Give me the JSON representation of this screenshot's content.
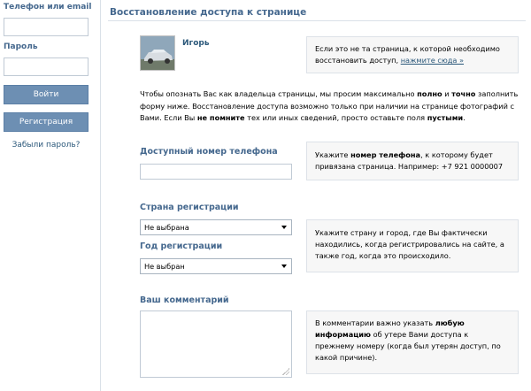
{
  "sidebar": {
    "login_label": "Телефон или email",
    "password_label": "Пароль",
    "login_button": "Войти",
    "register_button": "Регистрация",
    "forgot_link": "Забыли пароль?"
  },
  "main": {
    "title": "Восстановление доступа к странице",
    "user": {
      "name": "Игорь"
    },
    "wrong_page_hint": {
      "text": "Если это не та страница, к которой необходимо восстановить доступ,",
      "link": "нажмите сюда »"
    },
    "intro": {
      "p1": "Чтобы опознать Вас как владельца страницы, мы просим максимально ",
      "b1": "полно",
      "p2": " и ",
      "b2": "точно",
      "p3": " заполнить форму ниже. Восстановление доступа возможно только при наличии на странице фотографий с Вами. Если Вы ",
      "b3": "не помните",
      "p4": " тех или иных сведений, просто оставьте поля ",
      "b4": "пустыми",
      "p5": "."
    },
    "phone": {
      "label": "Доступный номер телефона",
      "hint_p1": "Укажите ",
      "hint_b1": "номер телефона",
      "hint_p2": ", к которому будет привязана страница. Например: +7 921 0000007"
    },
    "country": {
      "label": "Страна регистрации",
      "selected": "Не выбрана"
    },
    "year": {
      "label": "Год регистрации",
      "selected": "Не выбран"
    },
    "location_hint": "Укажите страну и город, где Вы фактически находились, когда регистрировались на сайте, а также год, когда это происходило.",
    "comment": {
      "label": "Ваш комментарий",
      "hint_p1": "В комментарии важно указать ",
      "hint_b1": "любую информацию",
      "hint_p2": " об утере Вами доступа к прежнему номеру (когда был утерян доступ, по какой причине)."
    }
  }
}
